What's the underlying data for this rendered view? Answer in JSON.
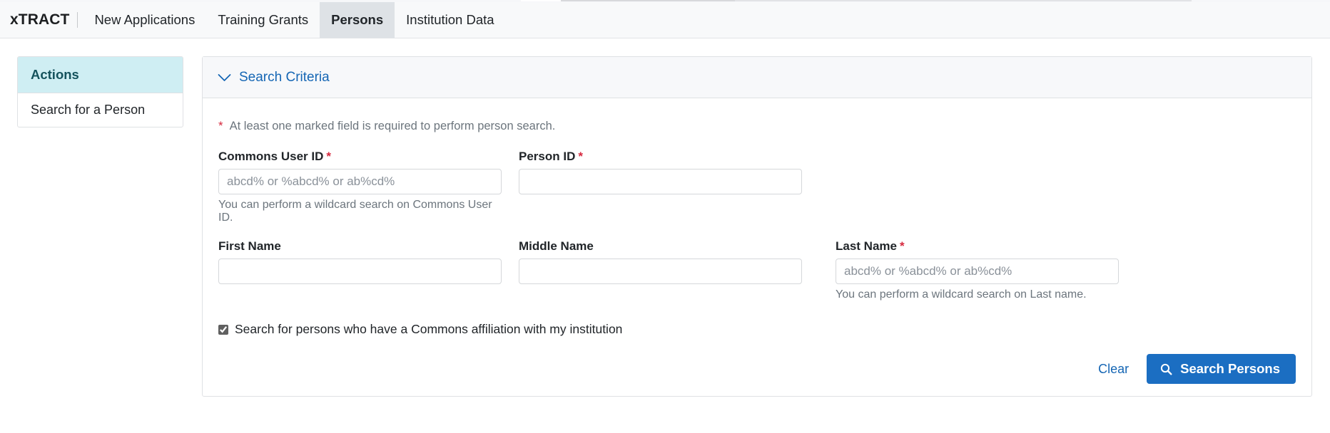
{
  "nav": {
    "brand": "xTRACT",
    "items": [
      {
        "label": "New Applications",
        "active": false
      },
      {
        "label": "Training Grants",
        "active": false
      },
      {
        "label": "Persons",
        "active": true
      },
      {
        "label": "Institution Data",
        "active": false
      }
    ]
  },
  "sidebar": {
    "header": "Actions",
    "items": [
      {
        "label": "Search for a Person"
      }
    ]
  },
  "card": {
    "header_title": "Search Criteria",
    "chevron_icon": "chevron-down-icon",
    "required_note": "At least one marked field is required to perform person search.",
    "required_marker": "*",
    "fields": {
      "commons_user_id": {
        "label": "Commons User ID",
        "required": true,
        "value": "",
        "placeholder": "abcd% or %abcd% or ab%cd%",
        "help": "You can perform a wildcard search on Commons User ID."
      },
      "person_id": {
        "label": "Person ID",
        "required": true,
        "value": "",
        "placeholder": "",
        "help": ""
      },
      "first_name": {
        "label": "First Name",
        "required": false,
        "value": "",
        "placeholder": "",
        "help": ""
      },
      "middle_name": {
        "label": "Middle Name",
        "required": false,
        "value": "",
        "placeholder": "",
        "help": ""
      },
      "last_name": {
        "label": "Last Name",
        "required": true,
        "value": "",
        "placeholder": "abcd% or %abcd% or ab%cd%",
        "help": "You can perform a wildcard search on Last name."
      }
    },
    "affiliation_checkbox": {
      "label": "Search for persons who have a Commons affiliation with my institution",
      "checked": true
    },
    "clear_label": "Clear",
    "search_label": "Search Persons",
    "search_icon": "search-icon"
  },
  "colors": {
    "primary_blue": "#1b6ec2",
    "link_blue": "#1566b4",
    "required_red": "#d6293e",
    "sidebar_header_bg": "#cfeef3",
    "active_tab_bg": "#dee2e6"
  }
}
